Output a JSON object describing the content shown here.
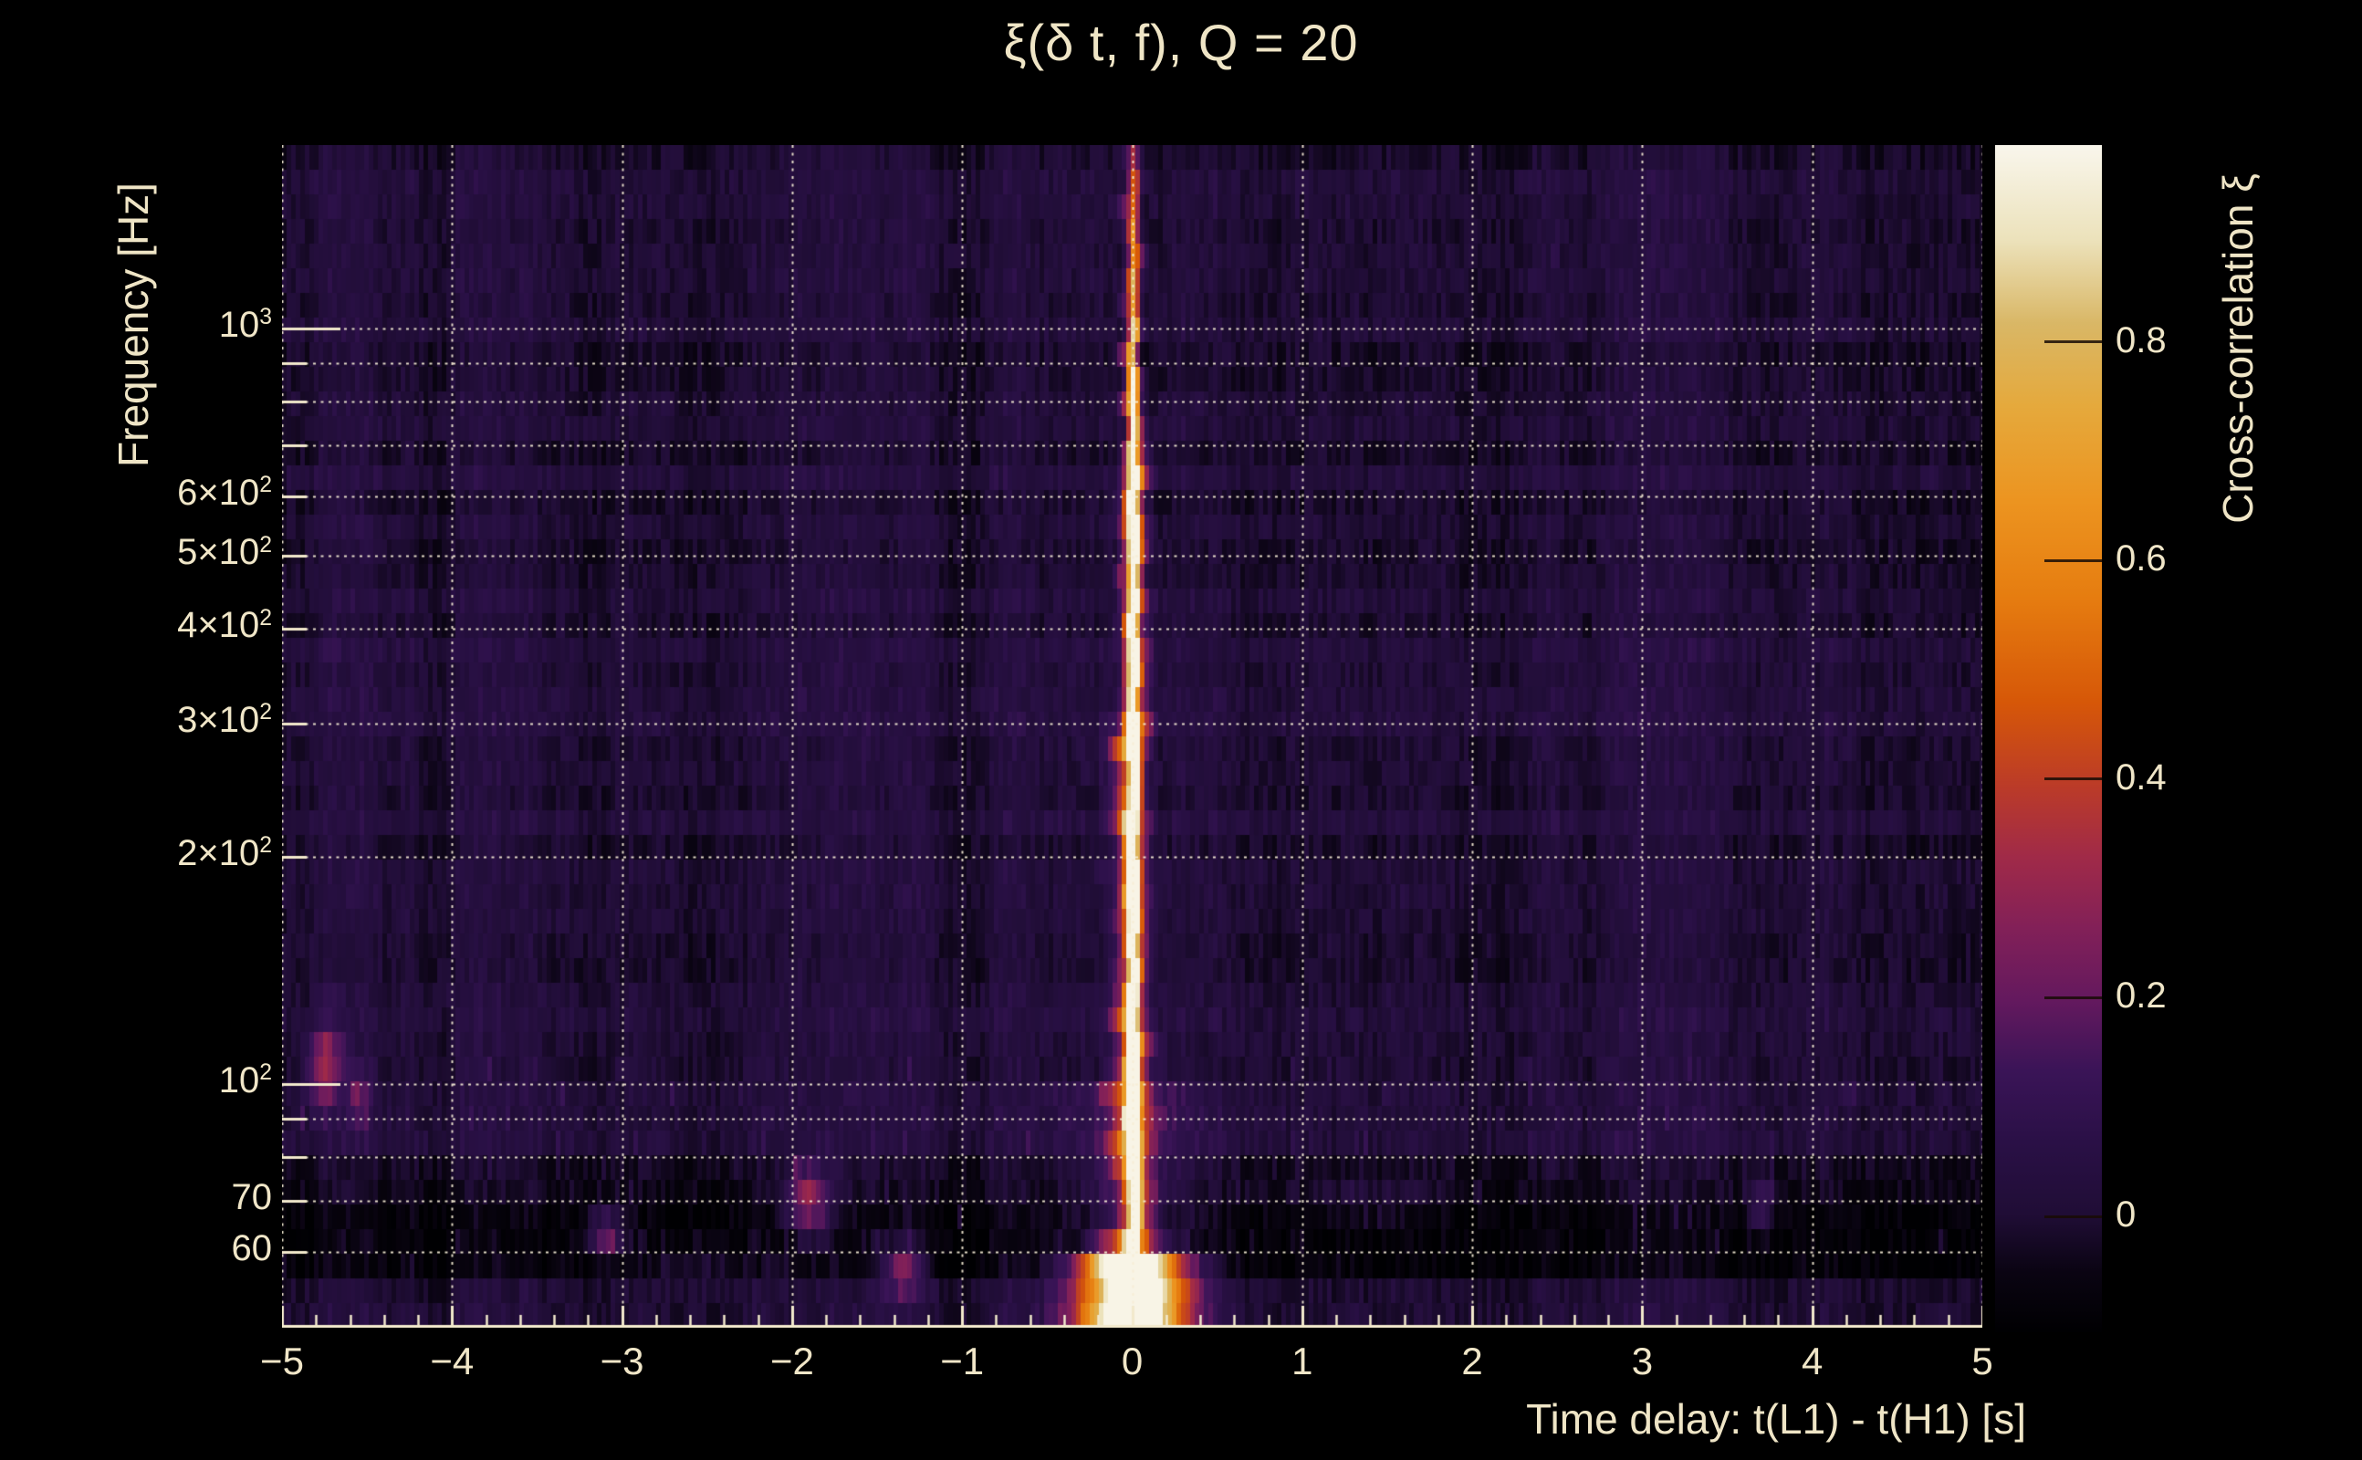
{
  "title": "ξ(δ t, f), Q = 20",
  "chart_data": {
    "type": "heatmap",
    "title": "ξ(δ t, f), Q = 20",
    "xlabel": "Time delay: t(L1) - t(H1) [s]",
    "ylabel": "Frequency [Hz]",
    "colorbar_label": "Cross-correlation ξ",
    "x_range": [
      -5,
      5
    ],
    "x_tick_labels": [
      "−5",
      "−4",
      "−3",
      "−2",
      "−1",
      "0",
      "1",
      "2",
      "3",
      "4",
      "5"
    ],
    "x_tick_values": [
      -5,
      -4,
      -3,
      -2,
      -1,
      0,
      1,
      2,
      3,
      4,
      5
    ],
    "x_minor_tick_step": 0.2,
    "y_scale": "log",
    "y_range_hz": [
      47.6,
      1750
    ],
    "y_tick_labels": [
      {
        "mantissa": "10",
        "exponent": "3",
        "hz": 1000
      },
      {
        "mantissa": "6×10",
        "exponent": "2",
        "hz": 600
      },
      {
        "mantissa": "5×10",
        "exponent": "2",
        "hz": 500
      },
      {
        "mantissa": "4×10",
        "exponent": "2",
        "hz": 400
      },
      {
        "mantissa": "3×10",
        "exponent": "2",
        "hz": 300
      },
      {
        "mantissa": "2×10",
        "exponent": "2",
        "hz": 200
      },
      {
        "mantissa": "10",
        "exponent": "2",
        "hz": 100
      },
      {
        "mantissa": "70",
        "exponent": "",
        "hz": 70
      },
      {
        "mantissa": "60",
        "exponent": "",
        "hz": 60
      }
    ],
    "y_gridlines_hz": [
      1000,
      900,
      800,
      700,
      600,
      500,
      400,
      300,
      200,
      100,
      90,
      80,
      70,
      60
    ],
    "grid_style": "dotted-cream",
    "colorbar": {
      "ticks": [
        0,
        0.2,
        0.4,
        0.6,
        0.8
      ],
      "tick_labels": [
        "0",
        "0.2",
        "0.4",
        "0.6",
        "0.8"
      ],
      "value_range": [
        -0.106,
        0.98
      ],
      "colormap_stops": [
        [
          0.0,
          "#000002"
        ],
        [
          0.05,
          "#0a0412"
        ],
        [
          0.1,
          "#200d36"
        ],
        [
          0.16,
          "#2a1046"
        ],
        [
          0.22,
          "#3a1457"
        ],
        [
          0.28,
          "#64195e"
        ],
        [
          0.34,
          "#822058"
        ],
        [
          0.4,
          "#a02a48"
        ],
        [
          0.46,
          "#bb3b28"
        ],
        [
          0.53,
          "#d65708"
        ],
        [
          0.62,
          "#e67d10"
        ],
        [
          0.7,
          "#ec9420"
        ],
        [
          0.78,
          "#e5a93c"
        ],
        [
          0.85,
          "#d9b766"
        ],
        [
          0.92,
          "#ece2bb"
        ],
        [
          1.0,
          "#f9f6ec"
        ]
      ]
    },
    "background_noise_xi_range": [
      -0.08,
      0.12
    ],
    "features": [
      {
        "name": "primary-ridge",
        "time_delay_s": 0.0,
        "freq_range_hz": [
          48,
          1500
        ],
        "peak_xi": 0.95,
        "note": "bright vertical ridge at zero time delay; widest and brightest (white-hot) below 100 Hz, orange wings through mid frequencies, fading to a faint narrow line above ~700 Hz"
      },
      {
        "name": "notch-band",
        "freq_range_hz": [
          55,
          76
        ],
        "xi": -0.08,
        "note": "dark horizontal band near 60-70 Hz"
      },
      {
        "name": "blob",
        "time_delay_s": -1.9,
        "freq_hz": 70,
        "xi": 0.34
      },
      {
        "name": "blob",
        "time_delay_s": -4.75,
        "freq_hz": 106,
        "xi": 0.3
      },
      {
        "name": "blob",
        "time_delay_s": -4.55,
        "freq_hz": 95,
        "xi": 0.16
      },
      {
        "name": "blob",
        "time_delay_s": -3.1,
        "freq_hz": 63,
        "xi": 0.27
      },
      {
        "name": "blob",
        "time_delay_s": -1.35,
        "freq_hz": 57,
        "xi": 0.32
      },
      {
        "name": "blob",
        "time_delay_s": 3.7,
        "freq_hz": 69,
        "xi": 0.17
      }
    ],
    "text_color": "#f0e6c8",
    "background_color": "#000000"
  }
}
